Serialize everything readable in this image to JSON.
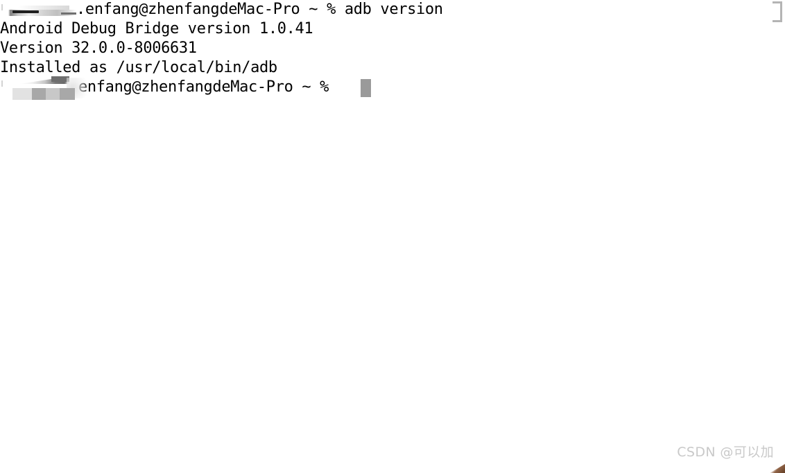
{
  "terminal": {
    "lines": [
      {
        "id": "command-line",
        "redacted_user": true,
        "text": ".enfang@zhenfangdeMac-Pro ~ % adb version"
      },
      {
        "id": "output-line-1",
        "redacted_user": false,
        "text": "Android Debug Bridge version 1.0.41"
      },
      {
        "id": "output-line-2",
        "redacted_user": false,
        "text": "Version 32.0.0-8006631"
      },
      {
        "id": "output-line-3",
        "redacted_user": false,
        "text": "Installed as /usr/local/bin/adb"
      },
      {
        "id": "prompt-line",
        "redacted_user": true,
        "text": "enfang@zhenfangdeMac-Pro ~ %"
      }
    ],
    "command": "adb version",
    "prompt_host": "zhenfangdeMac-Pro",
    "prompt_user_visible": "enfang",
    "prompt_cwd": "~",
    "prompt_symbol": "%",
    "adb": {
      "product": "Android Debug Bridge",
      "version_label": "version",
      "version": "1.0.41",
      "build_version": "32.0.0-8006631",
      "install_label": "Installed as",
      "install_path": "/usr/local/bin/adb"
    },
    "cursor": {
      "shape": "block",
      "color": "#9a9a9a"
    },
    "colors": {
      "background": "#ffffff",
      "foreground": "#000000",
      "cursor": "#9a9a9a",
      "redaction_dark": "#a8a8a8",
      "redaction_light": "#e2e2e2",
      "bracket": "#b4b4b4",
      "watermark": "#c9c9c9"
    }
  },
  "watermark": {
    "text": "CSDN @可以加"
  }
}
